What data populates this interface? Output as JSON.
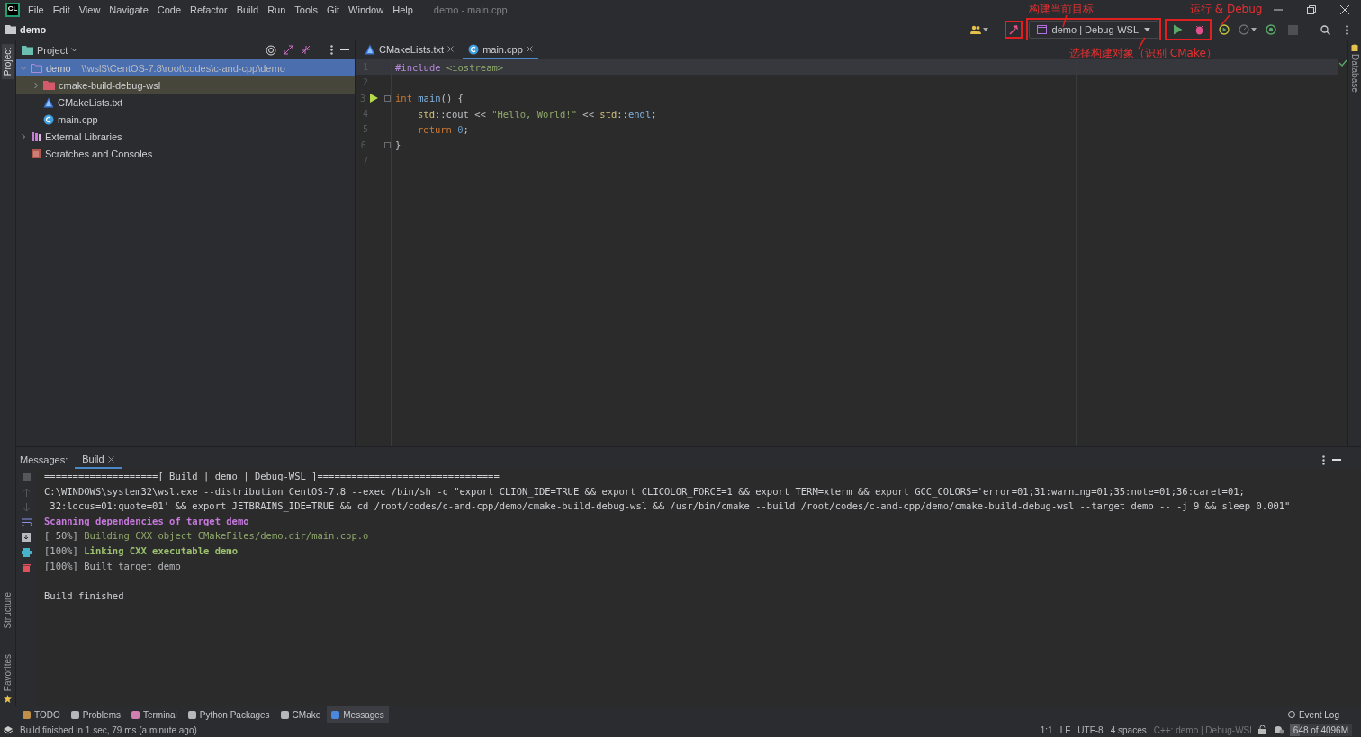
{
  "window": {
    "app_logo": "CL",
    "title": "demo - main.cpp"
  },
  "menu": [
    "File",
    "Edit",
    "View",
    "Navigate",
    "Code",
    "Refactor",
    "Build",
    "Run",
    "Tools",
    "Git",
    "Window",
    "Help"
  ],
  "breadcrumb": "demo",
  "toolbar": {
    "run_config": "demo | Debug-WSL",
    "stop_disabled": true
  },
  "annotations": [
    {
      "text": "构建当前目标"
    },
    {
      "text": "运行 & Debug"
    },
    {
      "text": "选择构建对象（识别 CMake）"
    }
  ],
  "left_stripe": [
    {
      "label": "Project",
      "selected": true
    },
    {
      "label": "Structure",
      "selected": false
    },
    {
      "label": "Favorites",
      "selected": false
    }
  ],
  "right_stripe": [
    "Database"
  ],
  "project_panel": {
    "title": "Project",
    "tree": [
      {
        "label": "demo",
        "path": "\\\\wsl$\\CentOS-7.8\\root\\codes\\c-and-cpp\\demo",
        "kind": "folder",
        "expanded": true,
        "selected": true,
        "highlighted": false,
        "children": [
          {
            "label": "cmake-build-debug-wsl",
            "kind": "excluded-folder",
            "expanded": false,
            "selected": false,
            "highlighted": true
          },
          {
            "label": "CMakeLists.txt",
            "kind": "cmake",
            "selected": false,
            "highlighted": false
          },
          {
            "label": "main.cpp",
            "kind": "cpp",
            "selected": false,
            "highlighted": false
          }
        ]
      },
      {
        "label": "External Libraries",
        "kind": "libraries",
        "expanded": false,
        "selected": false,
        "highlighted": false
      },
      {
        "label": "Scratches and Consoles",
        "kind": "scratches",
        "selected": false,
        "highlighted": false
      }
    ]
  },
  "editor": {
    "tabs": [
      {
        "label": "CMakeLists.txt",
        "kind": "cmake",
        "selected": false
      },
      {
        "label": "main.cpp",
        "kind": "cpp",
        "selected": true
      }
    ],
    "lines": [
      {
        "number": "1",
        "kind": "top",
        "current": true,
        "tokens": [
          {
            "kind": "directive",
            "text": "#include "
          },
          {
            "kind": "string",
            "text": "<iostream>"
          }
        ]
      },
      {
        "number": "2",
        "kind": "blank",
        "current": false
      },
      {
        "number": "3",
        "kind": "top",
        "current": false,
        "run_marker": true,
        "fold": true,
        "tokens": [
          {
            "kind": "keyword",
            "text": "int "
          },
          {
            "kind": "function",
            "text": "main"
          },
          {
            "kind": "plain",
            "text": "() {"
          }
        ]
      },
      {
        "number": "4",
        "kind": "body",
        "current": false,
        "tokens": [
          {
            "kind": "ns",
            "text": "std"
          },
          {
            "kind": "plain",
            "text": "::cout << "
          },
          {
            "kind": "string",
            "text": "\"Hello, World!\""
          },
          {
            "kind": "plain",
            "text": " << "
          },
          {
            "kind": "ns",
            "text": "std"
          },
          {
            "kind": "plain",
            "text": "::"
          },
          {
            "kind": "function",
            "text": "endl"
          },
          {
            "kind": "plain",
            "text": ";"
          }
        ]
      },
      {
        "number": "5",
        "kind": "body",
        "current": false,
        "tokens": [
          {
            "kind": "keyword",
            "text": "return "
          },
          {
            "kind": "number",
            "text": "0"
          },
          {
            "kind": "plain",
            "text": ";"
          }
        ]
      },
      {
        "number": "6",
        "kind": "top",
        "current": false,
        "fold": true,
        "tokens": [
          {
            "kind": "plain",
            "text": "}"
          }
        ]
      },
      {
        "number": "7",
        "kind": "blank",
        "current": false
      }
    ]
  },
  "messages": {
    "label": "Messages:",
    "tabs": [
      {
        "label": "Build",
        "selected": true
      }
    ],
    "lines": [
      {
        "kind": "plain",
        "text": "====================[ Build | demo | Debug-WSL ]================================"
      },
      {
        "kind": "plain",
        "text": "C:\\WINDOWS\\system32\\wsl.exe --distribution CentOS-7.8 --exec /bin/sh -c \"export CLION_IDE=TRUE && export CLICOLOR_FORCE=1 && export TERM=xterm && export GCC_COLORS='error=01;31:warning=01;35:note=01;36:caret=01;"
      },
      {
        "kind": "plain",
        "text": " 32:locus=01:quote=01' && export JETBRAINS_IDE=TRUE && cd /root/codes/c-and-cpp/demo/cmake-build-debug-wsl && /usr/bin/cmake --build /root/codes/c-and-cpp/demo/cmake-build-debug-wsl --target demo -- -j 9 && sleep 0.001\""
      },
      {
        "kind": "magenta-bold",
        "text": "Scanning dependencies of target demo"
      },
      {
        "kind": "progress-green",
        "prefix": "[ 50%]",
        "text": "Building CXX object CMakeFiles/demo.dir/main.cpp.o"
      },
      {
        "kind": "progress-green-bold",
        "prefix": "[100%]",
        "text": "Linking CXX executable demo"
      },
      {
        "kind": "progress-plain",
        "prefix": "[100%]",
        "text": "Built target demo"
      },
      {
        "kind": "blank"
      },
      {
        "kind": "plain",
        "text": "Build finished"
      }
    ]
  },
  "tool_windows": [
    {
      "label": "TODO",
      "selected": false
    },
    {
      "label": "Problems",
      "selected": false
    },
    {
      "label": "Terminal",
      "selected": false
    },
    {
      "label": "Python Packages",
      "selected": false
    },
    {
      "label": "CMake",
      "selected": false
    },
    {
      "label": "Messages",
      "selected": true
    }
  ],
  "event_log": "Event Log",
  "status_bar": {
    "message": "Build finished in 1 sec, 79 ms (a minute ago)",
    "items": [
      "1:1",
      "LF",
      "UTF-8",
      "4 spaces",
      "C++: demo | Debug-WSL"
    ],
    "memory": {
      "text": "648 of 4096M",
      "level": 0.16
    }
  }
}
